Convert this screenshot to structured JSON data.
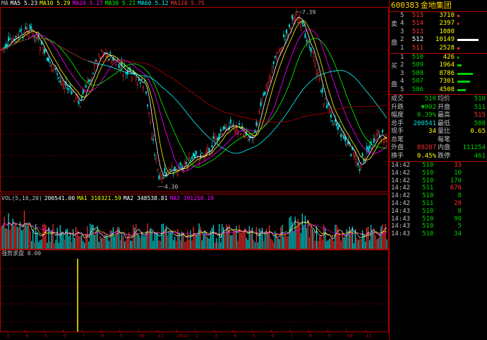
{
  "colors": {
    "up": "#ff3030",
    "down": "#00e0e0",
    "grid": "#b00000",
    "ma5": "#ffffff",
    "ma10": "#ffff00",
    "ma20": "#ff00ff",
    "ma30": "#00ff00",
    "ma60": "#00ffff",
    "ma120": "#b00000"
  },
  "chart": {
    "ma_legend": [
      {
        "label": "MA",
        "color": "#c0c0c0"
      },
      {
        "label": "MA5 5.23",
        "color": "#ffffff"
      },
      {
        "label": "MA10 5.29",
        "color": "#ffff00"
      },
      {
        "label": "MA20 5.27",
        "color": "#ff00ff"
      },
      {
        "label": "MA30 5.21",
        "color": "#00ff00"
      },
      {
        "label": "MA60 5.12",
        "color": "#00ffff"
      },
      {
        "label": "MA120 5.75",
        "color": "#ff3030"
      }
    ],
    "high_label": "7.39",
    "low_label": "4.30",
    "vol_legend": [
      {
        "label": "VOL(5,10,20)",
        "color": "#c0c0c0"
      },
      {
        "label": "200541.00",
        "color": "#ffffff"
      },
      {
        "label": "MA1 310321.59",
        "color": "#ffff00"
      },
      {
        "label": "MA2 348538.81",
        "color": "#ffffff"
      },
      {
        "label": "MA3 391250.19",
        "color": "#ff00ff"
      }
    ],
    "indicator_label": "强势求盘 0.00",
    "x_labels": [
      "3",
      "4",
      "5",
      "6",
      "7",
      "8",
      "9",
      "10",
      "11",
      "2012",
      "2",
      "3",
      "4",
      "5",
      "6",
      "7",
      "8",
      "9",
      "10",
      "11"
    ]
  },
  "panel": {
    "code": "600383",
    "name": "金地集团",
    "sell_label": [
      "卖",
      "盘"
    ],
    "buy_label": [
      "买",
      "盘"
    ],
    "asks": [
      {
        "level": "5",
        "price": "515",
        "qty": "3710",
        "bar": 3
      },
      {
        "level": "4",
        "price": "514",
        "qty": "2397",
        "bar": 2
      },
      {
        "level": "3",
        "price": "513",
        "qty": "1080",
        "bar": 0
      },
      {
        "level": "2",
        "price": "512",
        "qty": "10149",
        "bar": 30
      },
      {
        "level": "1",
        "price": "511",
        "qty": "2528",
        "bar": 3
      }
    ],
    "bids": [
      {
        "level": "1",
        "price": "510",
        "qty": "426",
        "bar": 2
      },
      {
        "level": "2",
        "price": "509",
        "qty": "1964",
        "bar": 6
      },
      {
        "level": "3",
        "price": "508",
        "qty": "8786",
        "bar": 22
      },
      {
        "level": "4",
        "price": "507",
        "qty": "7301",
        "bar": 18
      },
      {
        "level": "5",
        "price": "506",
        "qty": "4508",
        "bar": 12
      }
    ],
    "stats": [
      {
        "l1": "成交",
        "v1": "510",
        "l2": "均价",
        "v2": "510",
        "c1": "green",
        "c2": "green"
      },
      {
        "l1": "升跌",
        "v1": "▼002",
        "l2": "开盘",
        "v2": "511",
        "c1": "green",
        "c2": "green"
      },
      {
        "l1": "幅度",
        "v1": "0.39%",
        "l2": "最高",
        "v2": "515",
        "c1": "green",
        "c2": "red"
      },
      {
        "l1": "总手",
        "v1": "200541",
        "l2": "最低",
        "v2": "508",
        "c1": "cyan",
        "c2": "green"
      },
      {
        "l1": "现手",
        "v1": "34",
        "l2": "量比",
        "v2": "0.65",
        "c1": "yellow",
        "c2": "yellow"
      },
      {
        "l1": "总笔",
        "v1": "",
        "l2": "每笔",
        "v2": "",
        "c1": "grey",
        "c2": "grey"
      },
      {
        "l1": "外盘",
        "v1": "89287",
        "l2": "内盘",
        "v2": "111254",
        "c1": "red",
        "c2": "green"
      },
      {
        "l1": "换手",
        "v1": "0.45%",
        "l2": "跌停",
        "v2": "461",
        "c1": "yellow",
        "c2": "green"
      }
    ],
    "ticks": [
      {
        "time": "14:42",
        "price": "510",
        "vol": "33",
        "pc": "green",
        "vc": "red"
      },
      {
        "time": "14:42",
        "price": "510",
        "vol": "10",
        "pc": "green",
        "vc": "green"
      },
      {
        "time": "14:42",
        "price": "510",
        "vol": "170",
        "pc": "green",
        "vc": "green"
      },
      {
        "time": "14:42",
        "price": "511",
        "vol": "676",
        "pc": "green",
        "vc": "red"
      },
      {
        "time": "14:42",
        "price": "510",
        "vol": "8",
        "pc": "green",
        "vc": "green"
      },
      {
        "time": "14:42",
        "price": "511",
        "vol": "20",
        "pc": "green",
        "vc": "red"
      },
      {
        "time": "14:43",
        "price": "510",
        "vol": "8",
        "pc": "green",
        "vc": "green"
      },
      {
        "time": "14:43",
        "price": "510",
        "vol": "90",
        "pc": "green",
        "vc": "green"
      },
      {
        "time": "14:43",
        "price": "510",
        "vol": "5",
        "pc": "green",
        "vc": "green"
      },
      {
        "time": "14:43",
        "price": "510",
        "vol": "34",
        "pc": "green",
        "vc": "green"
      }
    ]
  }
}
